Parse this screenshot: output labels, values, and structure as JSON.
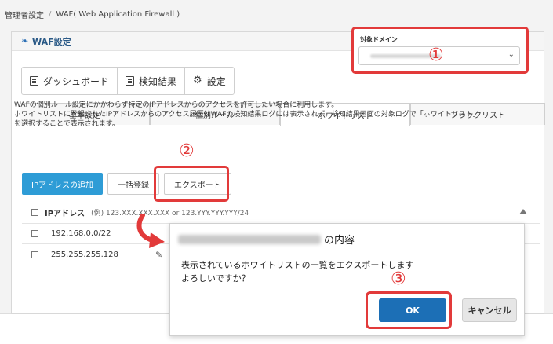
{
  "breadcrumb": {
    "items": [
      "管理者設定",
      "WAF( Web Application Firewall )"
    ],
    "separator": "/"
  },
  "panel": {
    "title": "WAF設定"
  },
  "nav_buttons": [
    {
      "label": "ダッシュボード",
      "icon": "document-icon"
    },
    {
      "label": "検知結果",
      "icon": "document-icon"
    },
    {
      "label": "設定",
      "icon": "gear-icon"
    }
  ],
  "domain": {
    "label": "対象ドメイン"
  },
  "tabs": [
    {
      "label": "基本設定"
    },
    {
      "label": "個別ルール"
    },
    {
      "label": "ホワイトリスト"
    },
    {
      "label": "ブラックリスト"
    }
  ],
  "description": {
    "line1": "WAFの個別ルール設定にかかわらず特定のIPアドレスからのアクセスを許可したい場合に利用します。",
    "line2": "ホワイトリストに登録されたIPアドレスからのアクセス履歴はWAFの検知結果ログには表示されず、検知結果画面の対象ログで「ホワイトリスト」",
    "line3": "を選択することで表示されます。"
  },
  "actions": {
    "add_ip": "IPアドレスの追加",
    "bulk": "一括登録",
    "export": "エクスポート"
  },
  "whitelist": {
    "header": "IPアドレス",
    "example": "(例) 123.XXX.XXX.XXX or 123.YYY.YYY.YYY/24",
    "rows": [
      "192.168.0.0/22",
      "255.255.255.128"
    ]
  },
  "dialog": {
    "title_suffix": "の内容",
    "message_line1": "表示されているホワイトリストの一覧をエクスポートします",
    "message_line2": "よろしいですか？",
    "ok_label": "OK",
    "cancel_label": "キャンセル"
  },
  "markers": {
    "m1": "①",
    "m2": "②",
    "m3": "③"
  },
  "colors": {
    "highlight": "#e23a3a",
    "primary": "#2e9cd6",
    "ok": "#1c6fb6"
  }
}
